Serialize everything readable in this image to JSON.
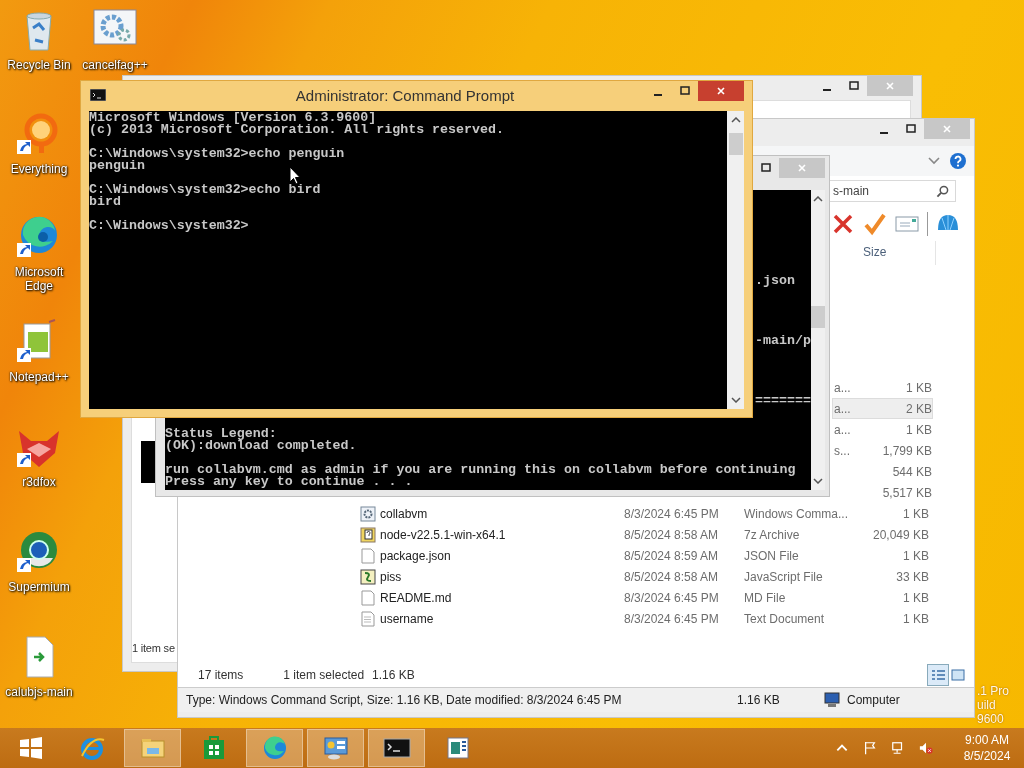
{
  "desktop_icons": [
    {
      "label": "Recycle Bin",
      "kind": "recycle",
      "shortcut": false
    },
    {
      "label": "cancelfag++",
      "kind": "gears",
      "shortcut": false
    },
    {
      "label": "Everything",
      "kind": "ring",
      "shortcut": true
    },
    {
      "label": "Microsoft Edge",
      "kind": "edge",
      "shortcut": true
    },
    {
      "label": "Notepad++",
      "kind": "notepad",
      "shortcut": true
    },
    {
      "label": "r3dfox",
      "kind": "fox",
      "shortcut": true
    },
    {
      "label": "Supermium",
      "kind": "globe",
      "shortcut": true
    },
    {
      "label": "calubjs-main",
      "kind": "file",
      "shortcut": false
    }
  ],
  "os_edition": [
    ".1 Pro",
    "uild 9600"
  ],
  "back_window": {
    "status": "1 item se"
  },
  "explorer": {
    "search": "s-main",
    "column_header": "Size",
    "rows": [
      {
        "type": "a...",
        "size": "1 KB",
        "selected": false
      },
      {
        "type": "a...",
        "size": "2 KB",
        "selected": true
      },
      {
        "type": "a...",
        "size": "1 KB",
        "selected": false
      },
      {
        "type": "s...",
        "size": "1,799 KB",
        "selected": false
      },
      {
        "size": "544 KB",
        "selected": false
      },
      {
        "size": "5,517 KB",
        "selected": false
      },
      {
        "name": "collabvm",
        "date": "8/3/2024 6:45 PM",
        "type": "Windows Comma...",
        "size": "1 KB",
        "kind": "script",
        "selected": false
      },
      {
        "name": "node-v22.5.1-win-x64.1",
        "date": "8/5/2024 8:58 AM",
        "type": "7z Archive",
        "size": "20,049 KB",
        "kind": "archive",
        "selected": false
      },
      {
        "name": "package.json",
        "date": "8/5/2024 8:59 AM",
        "type": "JSON File",
        "size": "1 KB",
        "kind": "blank",
        "selected": false
      },
      {
        "name": "piss",
        "date": "8/5/2024 8:58 AM",
        "type": "JavaScript File",
        "size": "33 KB",
        "kind": "js",
        "selected": false
      },
      {
        "name": "README.md",
        "date": "8/3/2024 6:45 PM",
        "type": "MD File",
        "size": "1 KB",
        "kind": "blank",
        "selected": false
      },
      {
        "name": "username",
        "date": "8/3/2024 6:45 PM",
        "type": "Text Document",
        "size": "1 KB",
        "kind": "text",
        "selected": false
      }
    ],
    "status": {
      "items": "17 items",
      "selection": "1 item selected",
      "selection_size": "1.16 KB"
    },
    "details": {
      "description": "Type: Windows Command Script, Size: 1.16 KB, Date modified: 8/3/2024 6:45 PM",
      "size": "1.16 KB",
      "location": "Computer"
    }
  },
  "console_back": {
    "fragments": [
      ".json",
      "-main/p",
      "======="
    ],
    "legend": [
      "Status Legend:",
      "(OK):download completed."
    ],
    "prompt": [
      "run collabvm.cmd as admin if you are running this on collabvm before continuing",
      "Press any key to continue . . ."
    ]
  },
  "console_front": {
    "title": "Administrator: Command Prompt",
    "blocks": [
      [
        "Microsoft Windows [Version 6.3.9600]",
        "(c) 2013 Microsoft Corporation. All rights reserved."
      ],
      [
        "C:\\Windows\\system32>echo penguin",
        "penguin"
      ],
      [
        "C:\\Windows\\system32>echo bird",
        "bird"
      ],
      [
        "C:\\Windows\\system32>"
      ]
    ]
  },
  "taskbar": {
    "items": [
      {
        "kind": "start",
        "active": false
      },
      {
        "kind": "ie",
        "active": false
      },
      {
        "kind": "folder",
        "active": true
      },
      {
        "kind": "store",
        "active": false
      },
      {
        "kind": "edge",
        "active": true
      },
      {
        "kind": "panel",
        "active": true
      },
      {
        "kind": "cmd",
        "active": true
      },
      {
        "kind": "app",
        "active": false
      }
    ],
    "time": "9:00 AM",
    "date": "8/5/2024"
  }
}
